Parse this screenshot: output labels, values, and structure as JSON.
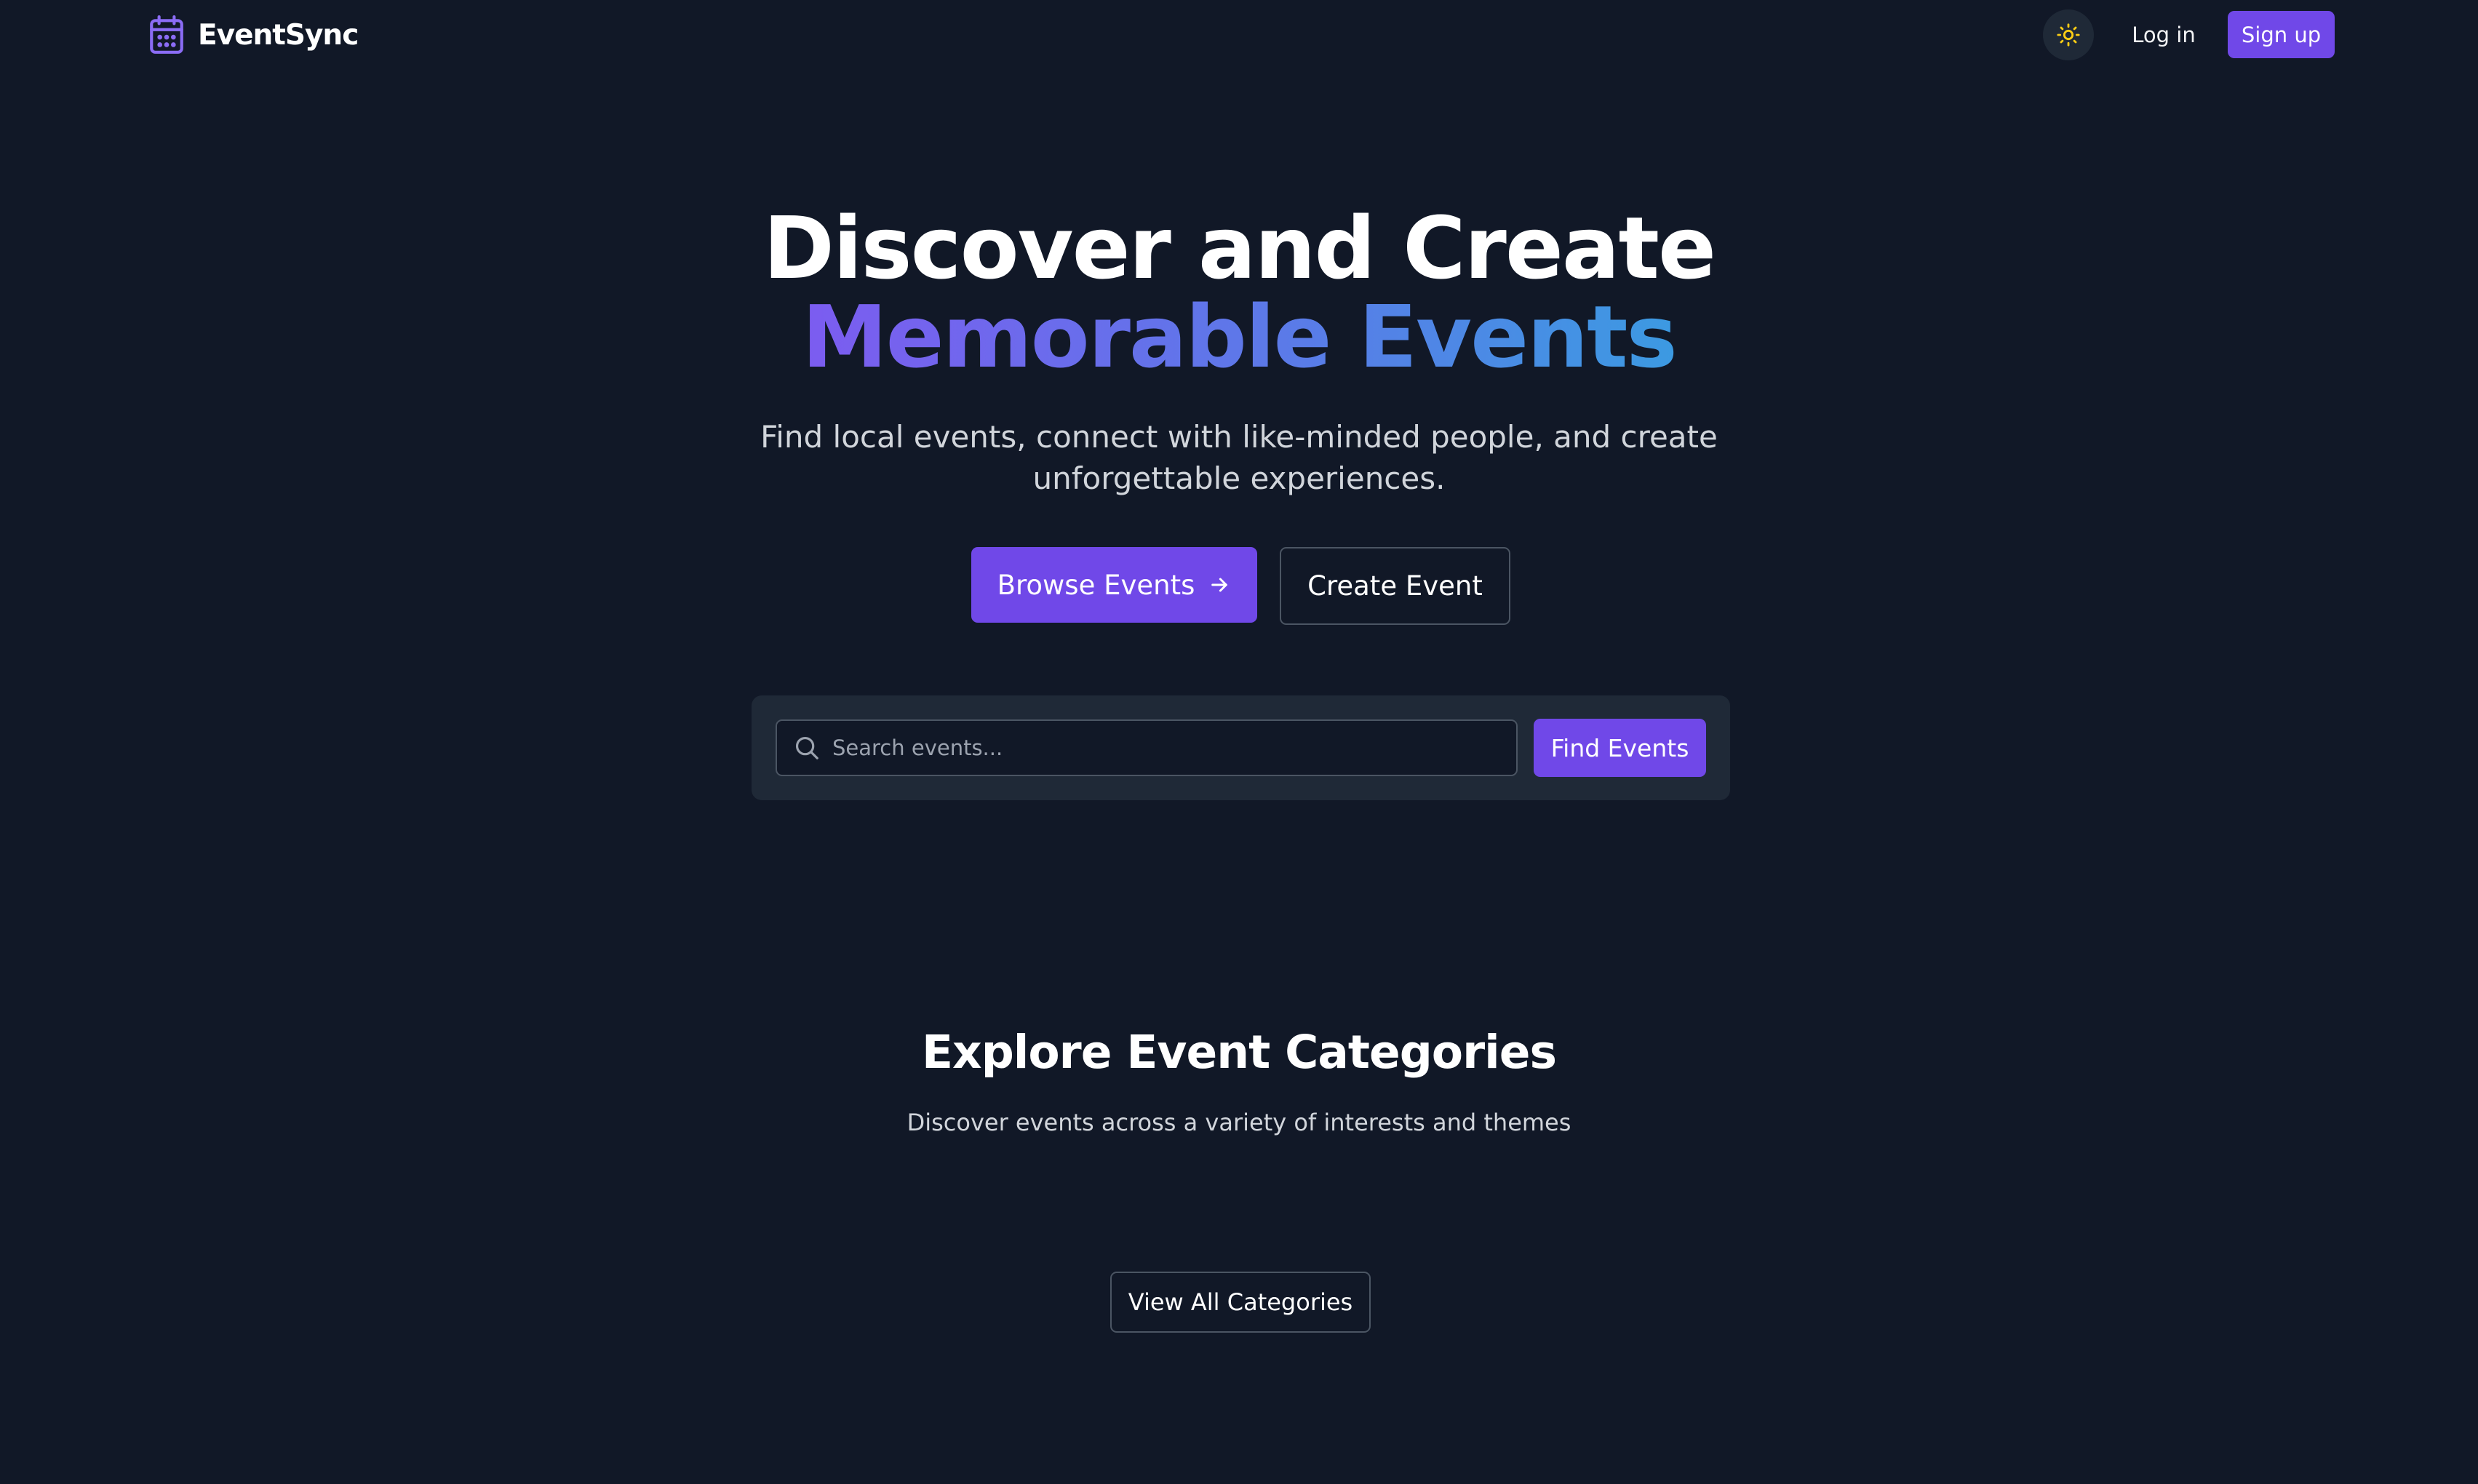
{
  "header": {
    "brand_name": "EventSync",
    "brand_icon": "calendar-icon",
    "theme_toggle_icon": "sun-icon",
    "login_label": "Log in",
    "signup_label": "Sign up"
  },
  "hero": {
    "title_line1": "Discover and Create",
    "title_line2": "Memorable Events",
    "subtitle": "Find local events, connect with like-minded people, and create unforgettable experiences.",
    "browse_label": "Browse Events",
    "browse_icon": "arrow-right-icon",
    "create_label": "Create Event"
  },
  "search": {
    "placeholder": "Search events...",
    "value": "",
    "icon": "search-icon",
    "button_label": "Find Events"
  },
  "categories": {
    "title": "Explore Event Categories",
    "subtitle": "Discover events across a variety of interests and themes",
    "view_all_label": "View All Categories"
  },
  "colors": {
    "background": "#111827",
    "panel": "#1f2937",
    "accent": "#7048e8",
    "gradient_start": "#7c5cf0",
    "gradient_end": "#3c9ae2",
    "sun": "#facc15"
  }
}
